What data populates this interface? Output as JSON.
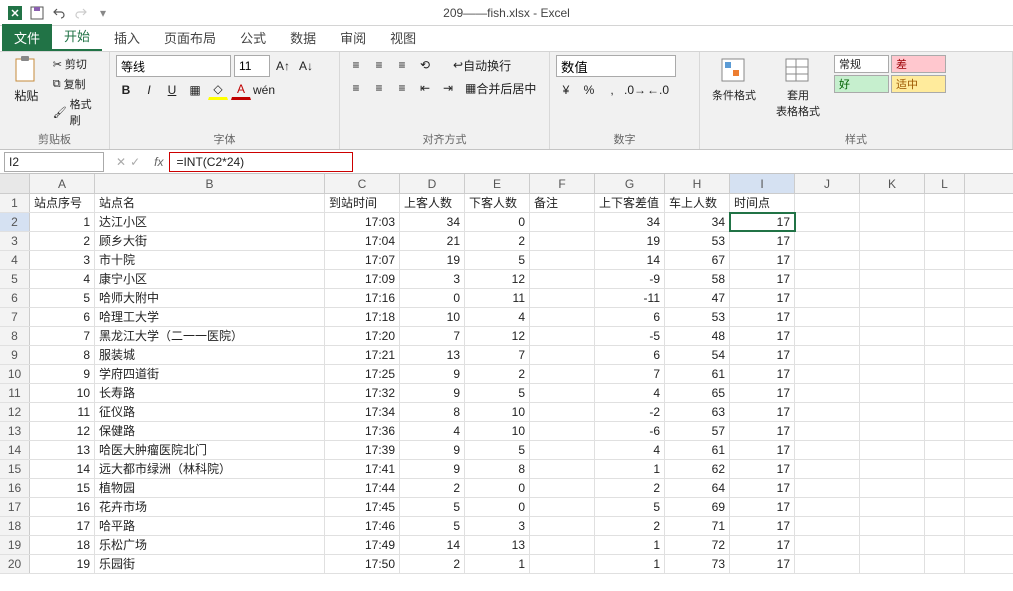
{
  "title": "209——fish.xlsx - Excel",
  "qat": {
    "save_icon": "save-icon",
    "undo_icon": "undo-icon",
    "redo_icon": "redo-icon"
  },
  "tabs": [
    "文件",
    "开始",
    "插入",
    "页面布局",
    "公式",
    "数据",
    "审阅",
    "视图"
  ],
  "active_tab": 1,
  "ribbon": {
    "clipboard": {
      "paste": "粘贴",
      "cut": "剪切",
      "copy": "复制",
      "format_painter": "格式刷",
      "label": "剪贴板"
    },
    "font": {
      "name": "等线",
      "size": "11",
      "label": "字体"
    },
    "align": {
      "wrap": "自动换行",
      "merge": "合并后居中",
      "label": "对齐方式"
    },
    "number": {
      "format": "数值",
      "label": "数字"
    },
    "styles": {
      "cond_fmt": "条件格式",
      "table_fmt": "套用\n表格格式",
      "normal": "常规",
      "bad": "差",
      "good": "好",
      "neutral": "适中",
      "label": "样式"
    }
  },
  "formula_bar": {
    "name_box": "I2",
    "formula": "=INT(C2*24)"
  },
  "col_letters": [
    "A",
    "B",
    "C",
    "D",
    "E",
    "F",
    "G",
    "H",
    "I",
    "J",
    "K",
    "L"
  ],
  "headers": [
    "站点序号",
    "站点名",
    "到站时间",
    "上客人数",
    "下客人数",
    "备注",
    "上下客差值",
    "车上人数",
    "时间点"
  ],
  "selected_cell": {
    "row": 2,
    "col": "I"
  },
  "chart_data": {
    "type": "table",
    "rows": [
      {
        "n": 1,
        "name": "达江小区",
        "time": "17:03",
        "on": 34,
        "off": 0,
        "diff": 34,
        "total": 34,
        "hour": 17
      },
      {
        "n": 2,
        "name": "顾乡大街",
        "time": "17:04",
        "on": 21,
        "off": 2,
        "diff": 19,
        "total": 53,
        "hour": 17
      },
      {
        "n": 3,
        "name": "市十院",
        "time": "17:07",
        "on": 19,
        "off": 5,
        "diff": 14,
        "total": 67,
        "hour": 17
      },
      {
        "n": 4,
        "name": "康宁小区",
        "time": "17:09",
        "on": 3,
        "off": 12,
        "diff": -9,
        "total": 58,
        "hour": 17
      },
      {
        "n": 5,
        "name": "哈师大附中",
        "time": "17:16",
        "on": 0,
        "off": 11,
        "diff": -11,
        "total": 47,
        "hour": 17
      },
      {
        "n": 6,
        "name": "哈理工大学",
        "time": "17:18",
        "on": 10,
        "off": 4,
        "diff": 6,
        "total": 53,
        "hour": 17
      },
      {
        "n": 7,
        "name": "黑龙江大学（二一一医院）",
        "time": "17:20",
        "on": 7,
        "off": 12,
        "diff": -5,
        "total": 48,
        "hour": 17
      },
      {
        "n": 8,
        "name": "服装城",
        "time": "17:21",
        "on": 13,
        "off": 7,
        "diff": 6,
        "total": 54,
        "hour": 17
      },
      {
        "n": 9,
        "name": "学府四道街",
        "time": "17:25",
        "on": 9,
        "off": 2,
        "diff": 7,
        "total": 61,
        "hour": 17
      },
      {
        "n": 10,
        "name": "长寿路",
        "time": "17:32",
        "on": 9,
        "off": 5,
        "diff": 4,
        "total": 65,
        "hour": 17
      },
      {
        "n": 11,
        "name": "征仪路",
        "time": "17:34",
        "on": 8,
        "off": 10,
        "diff": -2,
        "total": 63,
        "hour": 17
      },
      {
        "n": 12,
        "name": "保健路",
        "time": "17:36",
        "on": 4,
        "off": 10,
        "diff": -6,
        "total": 57,
        "hour": 17
      },
      {
        "n": 13,
        "name": "哈医大肿瘤医院北门",
        "time": "17:39",
        "on": 9,
        "off": 5,
        "diff": 4,
        "total": 61,
        "hour": 17
      },
      {
        "n": 14,
        "name": "远大都市绿洲（林科院）",
        "time": "17:41",
        "on": 9,
        "off": 8,
        "diff": 1,
        "total": 62,
        "hour": 17
      },
      {
        "n": 15,
        "name": "植物园",
        "time": "17:44",
        "on": 2,
        "off": 0,
        "diff": 2,
        "total": 64,
        "hour": 17
      },
      {
        "n": 16,
        "name": "花卉市场",
        "time": "17:45",
        "on": 5,
        "off": 0,
        "diff": 5,
        "total": 69,
        "hour": 17
      },
      {
        "n": 17,
        "name": "哈平路",
        "time": "17:46",
        "on": 5,
        "off": 3,
        "diff": 2,
        "total": 71,
        "hour": 17
      },
      {
        "n": 18,
        "name": "乐松广场",
        "time": "17:49",
        "on": 14,
        "off": 13,
        "diff": 1,
        "total": 72,
        "hour": 17
      },
      {
        "n": 19,
        "name": "乐园街",
        "time": "17:50",
        "on": 2,
        "off": 1,
        "diff": 1,
        "total": 73,
        "hour": 17
      }
    ]
  }
}
